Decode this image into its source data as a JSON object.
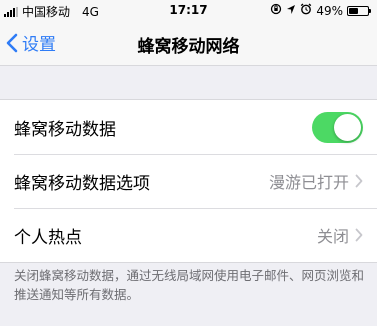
{
  "status_bar": {
    "carrier": "中国移动",
    "network": "4G",
    "time": "17:17",
    "battery_percent": "49%",
    "battery_level": 0.49,
    "signal_bars": 4
  },
  "nav": {
    "back_label": "设置",
    "title": "蜂窝移动网络"
  },
  "settings": {
    "cellular_data": {
      "label": "蜂窝移动数据",
      "enabled": true
    },
    "cellular_options": {
      "label": "蜂窝移动数据选项",
      "value": "漫游已打开"
    },
    "hotspot": {
      "label": "个人热点",
      "value": "关闭"
    }
  },
  "footer": {
    "note": "关闭蜂窝移动数据，通过无线局域网使用电子邮件、网页浏览和推送通知等所有数据。"
  },
  "colors": {
    "accent": "#2f7cf6",
    "toggle_on": "#4cd964",
    "secondary_text": "#8e8e93",
    "background": "#efeff4"
  },
  "icons": [
    "signal-icon",
    "portrait-lock-icon",
    "location-icon",
    "alarm-icon",
    "battery-icon",
    "back-chevron-icon",
    "chevron-right-icon"
  ]
}
